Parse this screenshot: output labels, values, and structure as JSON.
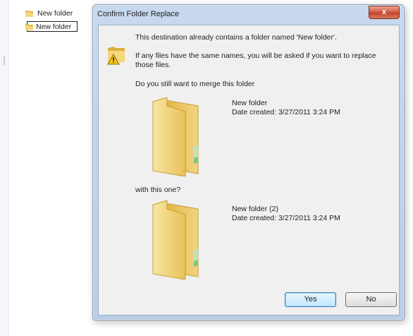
{
  "explorer": {
    "items": [
      {
        "label": "New folder"
      },
      {
        "label": "New folder"
      }
    ]
  },
  "dialog": {
    "title": "Confirm Folder Replace",
    "close_label": "x",
    "message_line1": "This destination already contains a folder named 'New folder'.",
    "message_line2": "If any files have the same names, you will be asked if you want to replace those files.",
    "message_line3": "Do you still want to merge this folder",
    "source": {
      "name": "New folder",
      "date": "Date created: 3/27/2011 3:24 PM"
    },
    "with_text": "with this one?",
    "destination": {
      "name": "New folder (2)",
      "date": "Date created: 3/27/2011 3:24 PM"
    },
    "yes_label": "Yes",
    "no_label": "No"
  },
  "icons": {
    "folder": "folder-icon",
    "warning": "warning-icon",
    "close": "close-icon"
  },
  "colors": {
    "titlebar": "#c3d5ec",
    "close_button": "#c4402a",
    "dialog_body": "#f0f0f0",
    "folder_yellow": "#f3d57a"
  }
}
